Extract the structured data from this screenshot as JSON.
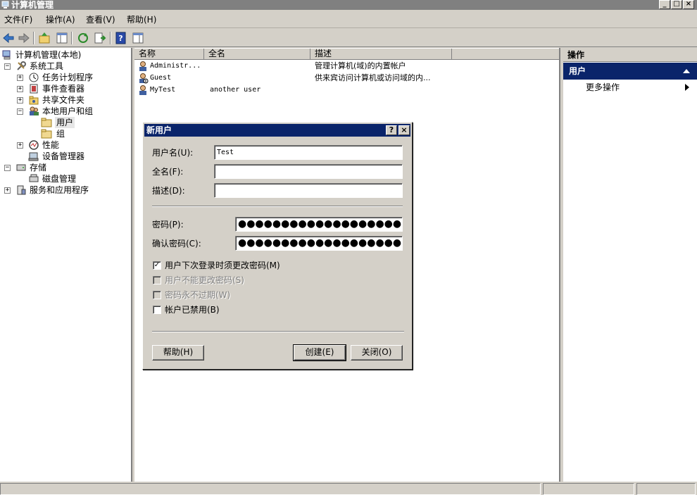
{
  "window": {
    "title": "计算机管理",
    "minimize_glyph": "_",
    "maximize_glyph": "□",
    "close_glyph": "×"
  },
  "menubar": {
    "items": [
      "文件(F)",
      "操作(A)",
      "查看(V)",
      "帮助(H)"
    ]
  },
  "toolbar": {
    "buttons": [
      "back-icon",
      "forward-icon",
      "up-folder-icon",
      "show-hide-tree-icon",
      "refresh-icon",
      "export-list-icon",
      "help-icon",
      "show-hide-action-pane-icon"
    ]
  },
  "tree": {
    "items": [
      {
        "label": "计算机管理(本地)",
        "icon": "computer-management-icon",
        "expander": ""
      },
      {
        "label": "系统工具",
        "icon": "system-tools-icon",
        "expander": "−"
      },
      {
        "label": "任务计划程序",
        "icon": "task-scheduler-icon",
        "expander": "+"
      },
      {
        "label": "事件查看器",
        "icon": "event-viewer-icon",
        "expander": "+"
      },
      {
        "label": "共享文件夹",
        "icon": "shared-folders-icon",
        "expander": "+"
      },
      {
        "label": "本地用户和组",
        "icon": "local-users-groups-icon",
        "expander": "−"
      },
      {
        "label": "用户",
        "icon": "folder-icon",
        "expander": ""
      },
      {
        "label": "组",
        "icon": "folder-icon",
        "expander": ""
      },
      {
        "label": "性能",
        "icon": "performance-icon",
        "expander": "+"
      },
      {
        "label": "设备管理器",
        "icon": "device-manager-icon",
        "expander": ""
      },
      {
        "label": "存储",
        "icon": "storage-icon",
        "expander": "−"
      },
      {
        "label": "磁盘管理",
        "icon": "disk-management-icon",
        "expander": ""
      },
      {
        "label": "服务和应用程序",
        "icon": "services-apps-icon",
        "expander": "+"
      }
    ]
  },
  "list": {
    "columns": [
      "名称",
      "全名",
      "描述"
    ],
    "rows": [
      {
        "name": "Administr...",
        "full_name": "",
        "description": "管理计算机(域)的内置帐户"
      },
      {
        "name": "Guest",
        "full_name": "",
        "description": "供来宾访问计算机或访问域的内..."
      },
      {
        "name": "MyTest",
        "full_name": "another user",
        "description": ""
      }
    ]
  },
  "actions": {
    "header": "操作",
    "section": "用户",
    "more": "更多操作"
  },
  "dialog": {
    "title": "新用户",
    "help_glyph": "?",
    "close_glyph": "×",
    "username_label": "用户名(U):",
    "username_value": "Test",
    "fullname_label": "全名(F):",
    "fullname_value": "",
    "description_label": "描述(D):",
    "description_value": "",
    "password_label": "密码(P):",
    "password_value": "●●●●●●●●●●●●●●●●●●●",
    "confirm_label": "确认密码(C):",
    "confirm_value": "●●●●●●●●●●●●●●●●●●●",
    "checkboxes": [
      {
        "label": "用户下次登录时须更改密码(M)",
        "checked": true,
        "enabled": true
      },
      {
        "label": "用户不能更改密码(S)",
        "checked": false,
        "enabled": false
      },
      {
        "label": "密码永不过期(W)",
        "checked": false,
        "enabled": false
      },
      {
        "label": "帐户已禁用(B)",
        "checked": false,
        "enabled": true
      }
    ],
    "help_button": "帮助(H)",
    "create_button": "创建(E)",
    "close_button": "关闭(O)"
  }
}
